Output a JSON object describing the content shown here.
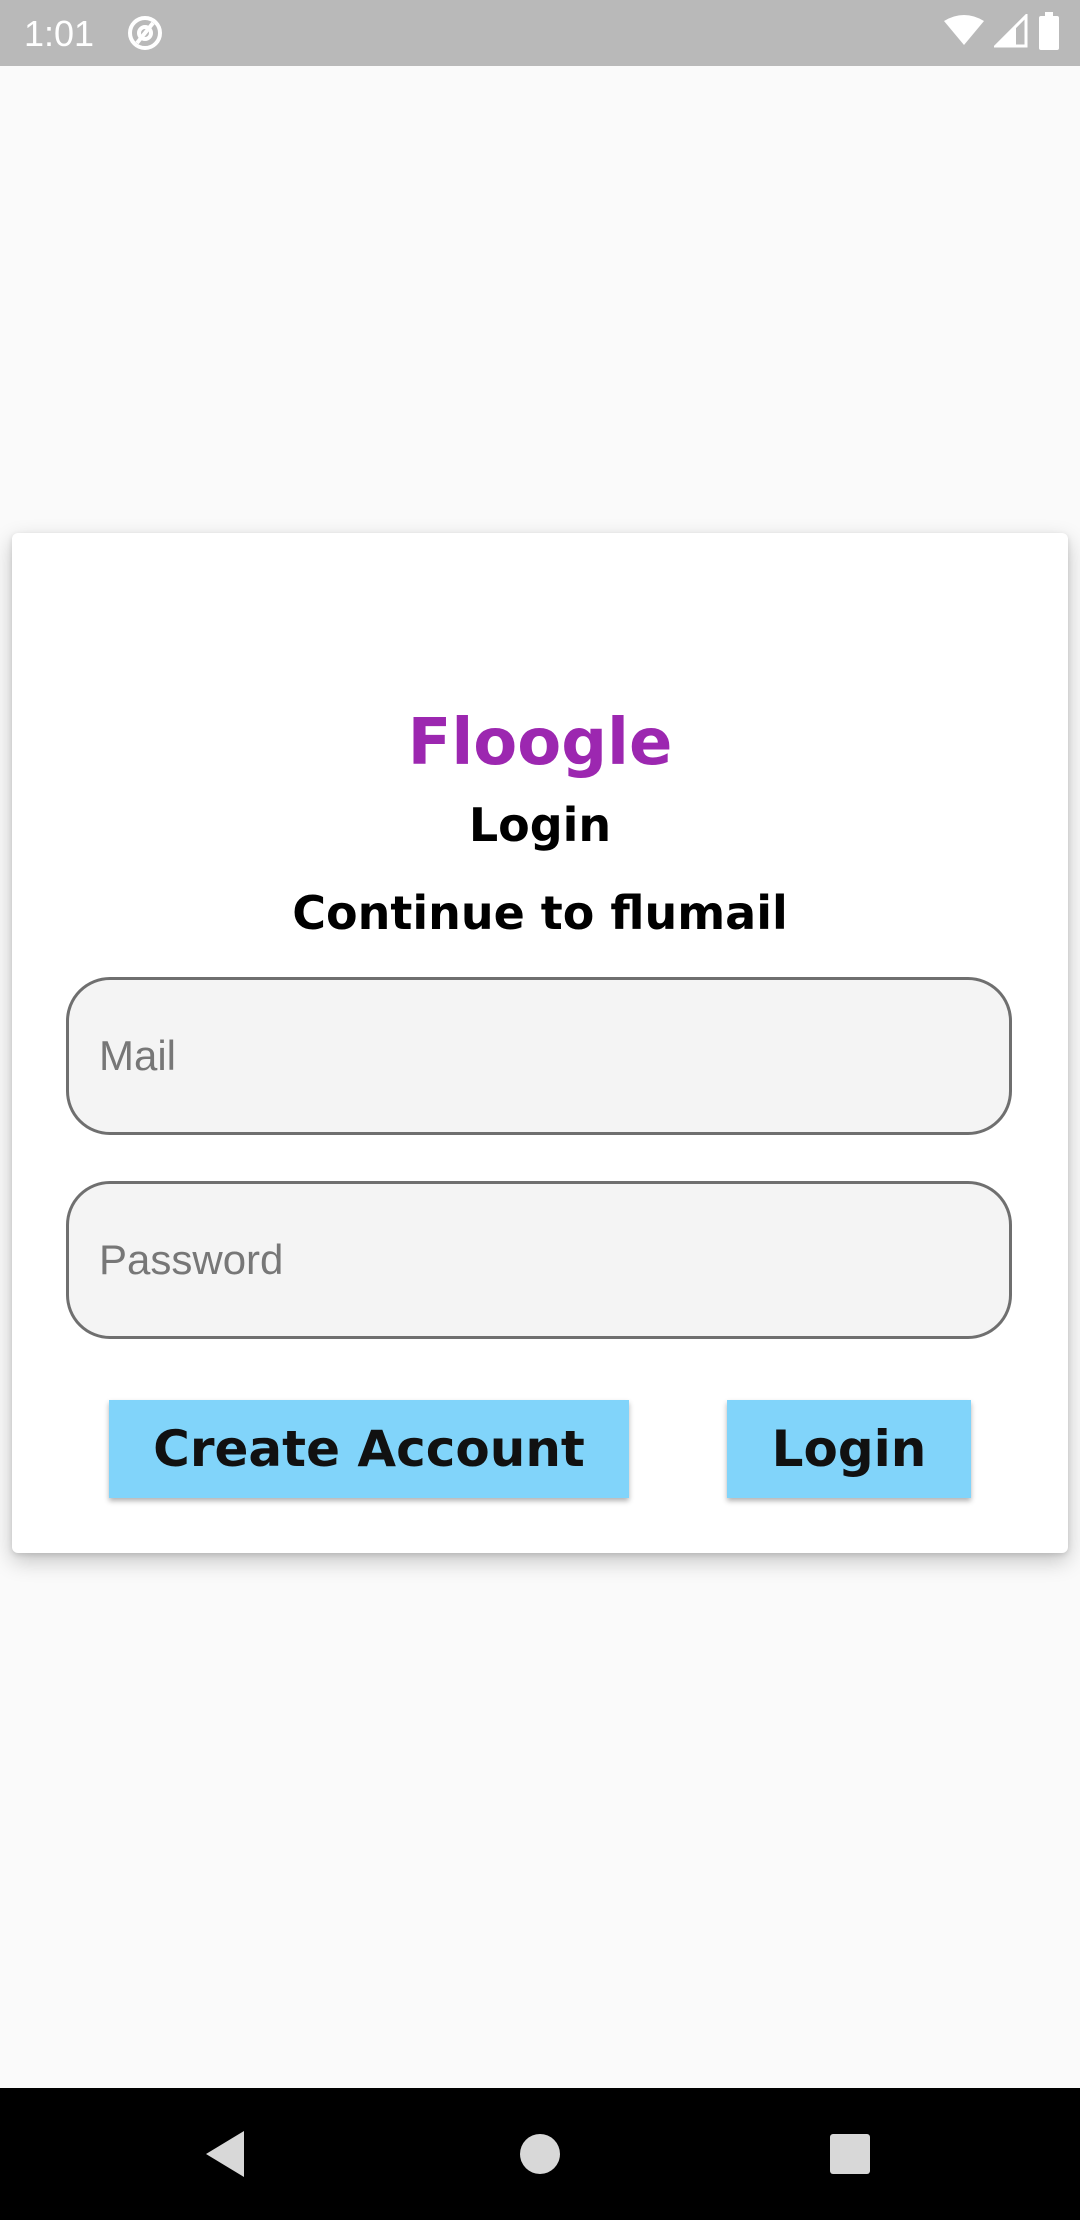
{
  "status_bar": {
    "time": "1:01",
    "notification_icon": "at-sign-icon",
    "icons": [
      "wifi-icon",
      "signal-icon",
      "battery-icon"
    ]
  },
  "login_card": {
    "brand": "Floogle",
    "heading": "Login",
    "subtitle": "Continue to flumail",
    "mail_placeholder": "Mail",
    "password_placeholder": "Password",
    "create_account_label": "Create Account",
    "login_label": "Login"
  },
  "nav_bar": {
    "icons": [
      "back-icon",
      "home-icon",
      "recents-icon"
    ]
  },
  "colors": {
    "brand": "#9c27b0",
    "button": "#81d4fa",
    "status_bar": "#b9b9b9",
    "background": "#fafafa"
  }
}
